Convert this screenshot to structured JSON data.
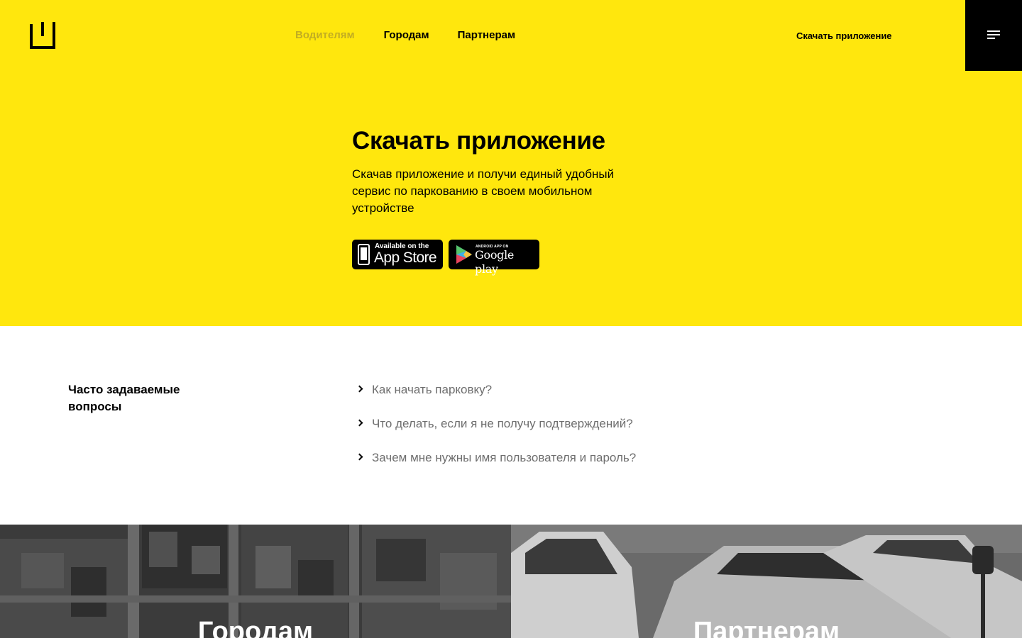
{
  "header": {
    "logo": "logo-icon",
    "nav": [
      "Водителям",
      "Городам",
      "Партнерам"
    ],
    "download_link": "Скачать приложение",
    "menu_icon": "menu-icon"
  },
  "hero": {
    "title": "Скачать приложение",
    "text": "Скачав приложение и получи единый удобный сервис по паркованию в своем мобильном устройстве",
    "app_store": {
      "small": "Available on the",
      "big": "App Store"
    },
    "google_play": {
      "small": "ANDROID APP ON",
      "big": "Google play"
    }
  },
  "faq": {
    "heading": "Часто задаваемые вопросы",
    "items": [
      "Как начать парковку?",
      "Что делать, если я не получу подтверждений?",
      "Зачем мне нужны имя пользователя и пароль?"
    ]
  },
  "tiles": {
    "cities": "Городам",
    "partners": "Партнерам"
  },
  "colors": {
    "accent": "#ffe70d",
    "dark": "#000000",
    "muted": "#6e6e6e",
    "nav_active": "#c2ad22"
  }
}
